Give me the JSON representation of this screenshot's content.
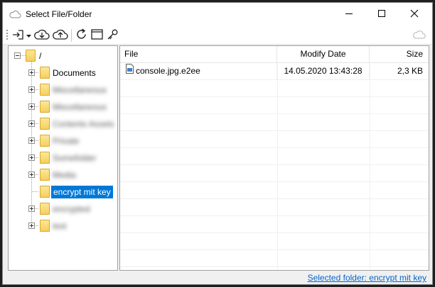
{
  "window": {
    "title": "Select File/Folder",
    "icons": [
      "cloud-icon",
      "minimize-icon",
      "maximize-icon",
      "close-icon"
    ]
  },
  "toolbar": {
    "buttons": [
      "import-icon",
      "dropdown-arrow-icon",
      "cloud-download-icon",
      "cloud-upload-icon",
      "refresh-icon",
      "window-icon",
      "key-icon",
      "cloud-icon"
    ]
  },
  "tree": {
    "root_label": "/",
    "items": [
      {
        "label": "Documents",
        "blurred": false,
        "selected": false,
        "expander": true
      },
      {
        "label": "Miscellaneous",
        "blurred": true,
        "selected": false,
        "expander": true
      },
      {
        "label": "Miscellaneous",
        "blurred": true,
        "selected": false,
        "expander": true
      },
      {
        "label": "Contents Assets",
        "blurred": true,
        "selected": false,
        "expander": true
      },
      {
        "label": "Private",
        "blurred": true,
        "selected": false,
        "expander": true
      },
      {
        "label": "Somefolder",
        "blurred": true,
        "selected": false,
        "expander": true
      },
      {
        "label": "Media",
        "blurred": true,
        "selected": false,
        "expander": true
      },
      {
        "label": "encrypt mit key",
        "blurred": false,
        "selected": true,
        "expander": false
      },
      {
        "label": "encrypted",
        "blurred": true,
        "selected": false,
        "expander": true
      },
      {
        "label": "test",
        "blurred": true,
        "selected": false,
        "expander": true
      }
    ]
  },
  "file_list": {
    "columns": [
      "File",
      "Modify Date",
      "Size"
    ],
    "rows": [
      {
        "name": "console.jpg.e2ee",
        "date": "14.05.2020 13:43:28",
        "size": "2,3 KB",
        "icon": "file-icon"
      }
    ]
  },
  "status": {
    "selected_folder": "Selected folder: encrypt mit key"
  }
}
